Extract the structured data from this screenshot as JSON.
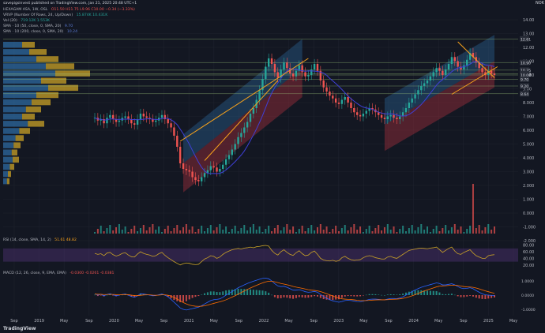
{
  "header": {
    "publish_line": "savepigsinvest published on TradingView.com, Jan 21, 2025 20:48 UTC+1",
    "symbol_line": "HEXAGAM ASA, 1W, OSL",
    "ohlc": "O11.50 H11.75 L9.96 C10.00 −0.34 (−3.33%)",
    "vrvp": "VRVP (Number Of Rows, 24, Up/Down)",
    "vrvp_vals": "15.874K 10.431K",
    "vol": "Vol (20)",
    "vol_vals": "719.12K 1.553K",
    "sma50": "SMA · 10 (50, close, 0, SMA, 20)",
    "sma50_val": "9.70",
    "sma200": "SMA · 10 (200, close, 0, SMA, 20)",
    "sma200_val": "10.24",
    "currency": "NOK",
    "rsi_label": "RSI (14, close, SMA, 14, 2)",
    "rsi_vals": "51.61 48.82",
    "macd_label": "MACD (12, 26, close, 9, EMA, EMA)",
    "macd_vals": "-0.0300 -0.0261 -0.0381",
    "logo": "TradingView"
  },
  "colors": {
    "background": "#131722",
    "up": "#26a69a",
    "down": "#ef5350",
    "sma_line": "#3f3fd6",
    "trend_line": "#f7a21b",
    "channel_blue": "#2f6fa8",
    "channel_red": "#b2333f",
    "rsi_line": "#c9a227",
    "rsi_band": "#4a2f6b",
    "macd_line": "#2962ff",
    "signal_line": "#ff6d00",
    "price_label": "#9598a1"
  },
  "chart_data": {
    "type": "candlestick",
    "x_ticks": [
      "Sep",
      "2019",
      "May",
      "Sep",
      "2020",
      "May",
      "Sep",
      "2021",
      "May",
      "Sep",
      "2022",
      "May",
      "Sep",
      "2023",
      "May",
      "Sep",
      "2024",
      "May",
      "Sep",
      "2025",
      "May"
    ],
    "y_ticks": [
      "-2.000",
      "-1.000",
      "0.000",
      "1.000",
      "2.000",
      "3.000",
      "4.000",
      "5.000",
      "6.000",
      "7.000",
      "8.000",
      "9.00",
      "10.00",
      "11.00",
      "12.00",
      "13.00",
      "14.00"
    ],
    "price_labels": [
      "12.61",
      "10.90",
      "10.35",
      "10.10",
      "10.00",
      "9.70",
      "9.20",
      "8.64"
    ],
    "current_price": "10.00",
    "rsi_ticks": [
      "80.00",
      "60.00",
      "40.00",
      "20.00"
    ],
    "macd_ticks": [
      "1.0000",
      "0.0000",
      "-1.0000"
    ],
    "close": [
      6.9,
      6.7,
      6.8,
      6.5,
      6.9,
      7.1,
      6.8,
      6.6,
      6.7,
      6.9,
      7.0,
      6.8,
      6.5,
      6.4,
      6.8,
      7.2,
      7.0,
      6.9,
      6.8,
      6.6,
      6.7,
      6.9,
      7.1,
      6.8,
      6.5,
      6.2,
      5.6,
      4.8,
      3.6,
      3.2,
      3.1,
      3.0,
      2.6,
      2.4,
      2.3,
      2.6,
      2.9,
      3.1,
      3.4,
      3.3,
      3.0,
      3.2,
      3.5,
      3.9,
      4.2,
      4.6,
      5.0,
      5.5,
      5.8,
      6.2,
      6.6,
      7.2,
      7.6,
      8.2,
      8.9,
      9.7,
      10.6,
      11.2,
      10.8,
      10.2,
      9.8,
      10.4,
      10.9,
      10.5,
      10.1,
      9.9,
      10.3,
      10.7,
      10.2,
      9.9,
      10.0,
      10.4,
      10.8,
      10.3,
      9.6,
      9.1,
      8.8,
      8.5,
      8.3,
      8.0,
      7.9,
      8.2,
      8.4,
      8.0,
      7.6,
      7.3,
      7.1,
      7.0,
      7.2,
      7.4,
      7.6,
      7.5,
      7.3,
      7.1,
      6.9,
      6.8,
      7.0,
      7.1,
      6.9,
      6.8,
      7.0,
      7.3,
      7.6,
      8.0,
      8.3,
      8.6,
      8.9,
      9.2,
      9.4,
      9.6,
      9.9,
      10.2,
      10.5,
      10.3,
      10.0,
      10.4,
      10.8,
      11.3,
      11.0,
      10.6,
      10.4,
      10.7,
      11.1,
      11.6,
      11.3,
      10.9,
      10.5,
      10.2,
      10.0,
      10.3,
      10.1,
      10.0
    ],
    "rsi": [
      55,
      52,
      54,
      48,
      56,
      58,
      51,
      47,
      50,
      55,
      57,
      50,
      45,
      44,
      53,
      60,
      55,
      52,
      50,
      46,
      48,
      54,
      58,
      49,
      42,
      36,
      30,
      25,
      20,
      24,
      26,
      25,
      22,
      21,
      22,
      30,
      38,
      42,
      48,
      46,
      40,
      44,
      52,
      58,
      62,
      66,
      68,
      70,
      68,
      71,
      72,
      74,
      72,
      75,
      76,
      78,
      79,
      77,
      64,
      55,
      50,
      60,
      66,
      58,
      52,
      49,
      57,
      63,
      54,
      48,
      50,
      58,
      62,
      52,
      40,
      35,
      33,
      32,
      34,
      31,
      33,
      42,
      46,
      40,
      36,
      34,
      35,
      36,
      42,
      46,
      48,
      46,
      42,
      40,
      38,
      38,
      44,
      46,
      42,
      40,
      46,
      52,
      58,
      64,
      66,
      68,
      70,
      71,
      70,
      69,
      71,
      72,
      74,
      66,
      58,
      64,
      70,
      74,
      62,
      54,
      52,
      58,
      62,
      66,
      56,
      48,
      44,
      40,
      40,
      48,
      50,
      51
    ],
    "macd": [
      0.1,
      0.0,
      0.05,
      -0.05,
      0.05,
      0.1,
      0.02,
      -0.05,
      0.0,
      0.05,
      0.08,
      0.0,
      -0.1,
      -0.15,
      -0.05,
      0.1,
      0.08,
      0.04,
      0.0,
      -0.05,
      -0.03,
      0.03,
      0.08,
      0.0,
      -0.12,
      -0.3,
      -0.5,
      -0.7,
      -0.9,
      -1.0,
      -1.05,
      -1.0,
      -0.95,
      -0.9,
      -0.85,
      -0.75,
      -0.62,
      -0.5,
      -0.38,
      -0.32,
      -0.3,
      -0.26,
      -0.15,
      0.0,
      0.12,
      0.25,
      0.38,
      0.52,
      0.62,
      0.72,
      0.82,
      0.9,
      0.98,
      1.05,
      1.12,
      1.18,
      1.2,
      1.15,
      1.0,
      0.8,
      0.65,
      0.6,
      0.62,
      0.55,
      0.45,
      0.35,
      0.35,
      0.38,
      0.32,
      0.24,
      0.2,
      0.22,
      0.26,
      0.2,
      0.05,
      -0.1,
      -0.22,
      -0.32,
      -0.4,
      -0.45,
      -0.5,
      -0.45,
      -0.38,
      -0.36,
      -0.38,
      -0.42,
      -0.45,
      -0.46,
      -0.42,
      -0.36,
      -0.3,
      -0.28,
      -0.28,
      -0.3,
      -0.32,
      -0.33,
      -0.28,
      -0.24,
      -0.24,
      -0.25,
      -0.2,
      -0.12,
      0.0,
      0.12,
      0.25,
      0.36,
      0.46,
      0.55,
      0.62,
      0.68,
      0.74,
      0.8,
      0.86,
      0.82,
      0.72,
      0.72,
      0.76,
      0.8,
      0.72,
      0.6,
      0.5,
      0.46,
      0.48,
      0.52,
      0.45,
      0.32,
      0.2,
      0.1,
      0.02,
      0.0,
      -0.02,
      -0.03
    ],
    "signal": [
      0.08,
      0.06,
      0.06,
      0.04,
      0.04,
      0.05,
      0.05,
      0.03,
      0.02,
      0.03,
      0.04,
      0.03,
      0.0,
      -0.03,
      -0.04,
      -0.01,
      0.01,
      0.02,
      0.02,
      0.0,
      -0.01,
      0.0,
      0.02,
      0.02,
      -0.01,
      -0.07,
      -0.16,
      -0.27,
      -0.4,
      -0.52,
      -0.62,
      -0.7,
      -0.75,
      -0.78,
      -0.79,
      -0.78,
      -0.75,
      -0.7,
      -0.64,
      -0.58,
      -0.52,
      -0.47,
      -0.41,
      -0.33,
      -0.24,
      -0.14,
      -0.04,
      0.07,
      0.18,
      0.29,
      0.4,
      0.5,
      0.6,
      0.69,
      0.78,
      0.86,
      0.93,
      0.98,
      0.98,
      0.94,
      0.88,
      0.82,
      0.78,
      0.73,
      0.68,
      0.61,
      0.56,
      0.52,
      0.48,
      0.43,
      0.38,
      0.35,
      0.33,
      0.3,
      0.25,
      0.18,
      0.1,
      0.02,
      -0.06,
      -0.14,
      -0.21,
      -0.26,
      -0.28,
      -0.3,
      -0.31,
      -0.33,
      -0.36,
      -0.38,
      -0.39,
      -0.38,
      -0.37,
      -0.35,
      -0.34,
      -0.33,
      -0.33,
      -0.33,
      -0.32,
      -0.3,
      -0.29,
      -0.28,
      -0.26,
      -0.23,
      -0.18,
      -0.12,
      -0.05,
      0.03,
      0.12,
      0.21,
      0.29,
      0.37,
      0.44,
      0.51,
      0.58,
      0.63,
      0.65,
      0.66,
      0.68,
      0.7,
      0.7,
      0.68,
      0.64,
      0.6,
      0.58,
      0.57,
      0.55,
      0.5,
      0.44,
      0.37,
      0.3,
      0.24,
      0.18,
      0.13
    ]
  }
}
